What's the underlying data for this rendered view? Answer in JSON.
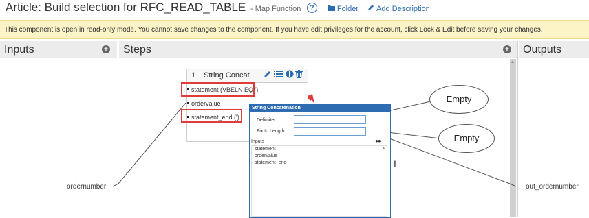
{
  "header": {
    "title": "Article: Build selection for RFC_READ_TABLE",
    "subtitle": "- Map Function",
    "help_icon": "?",
    "folder_label": "Folder",
    "add_description_label": "Add Description"
  },
  "banner": {
    "text": "This component is open in read-only mode. You cannot save changes to the component. If you have edit privileges for the account, click Lock & Edit before saving your changes."
  },
  "columns": {
    "inputs": "Inputs",
    "steps": "Steps",
    "outputs": "Outputs"
  },
  "step": {
    "number": "1",
    "name": "String Concat",
    "ports": [
      "statement (VBELN EQ ')",
      "ordervalue",
      "statement_end (')"
    ]
  },
  "inputs_panel": {
    "field": "ordernumber"
  },
  "outputs_panel": {
    "field": "out_ordernumber"
  },
  "dialog": {
    "title": "String Concatenation",
    "delimiter_label": "Delimiter",
    "delimiter_value": "",
    "fix_length_label": "Fix to Length",
    "fix_length_value": "",
    "inputs_label": "Inputs",
    "inputs": [
      "statement",
      "ordervalue",
      "statement_end"
    ]
  },
  "callouts": [
    "Empty",
    "Empty"
  ],
  "colors": {
    "accent": "#2d6cb0",
    "banner": "#fcf3c7",
    "highlight": "#e03c3c"
  },
  "icons": [
    "help-icon",
    "folder-icon",
    "pencil-icon",
    "add-circle-icon",
    "edit-icon",
    "list-icon",
    "info-icon",
    "trash-icon",
    "cursor-icon"
  ]
}
